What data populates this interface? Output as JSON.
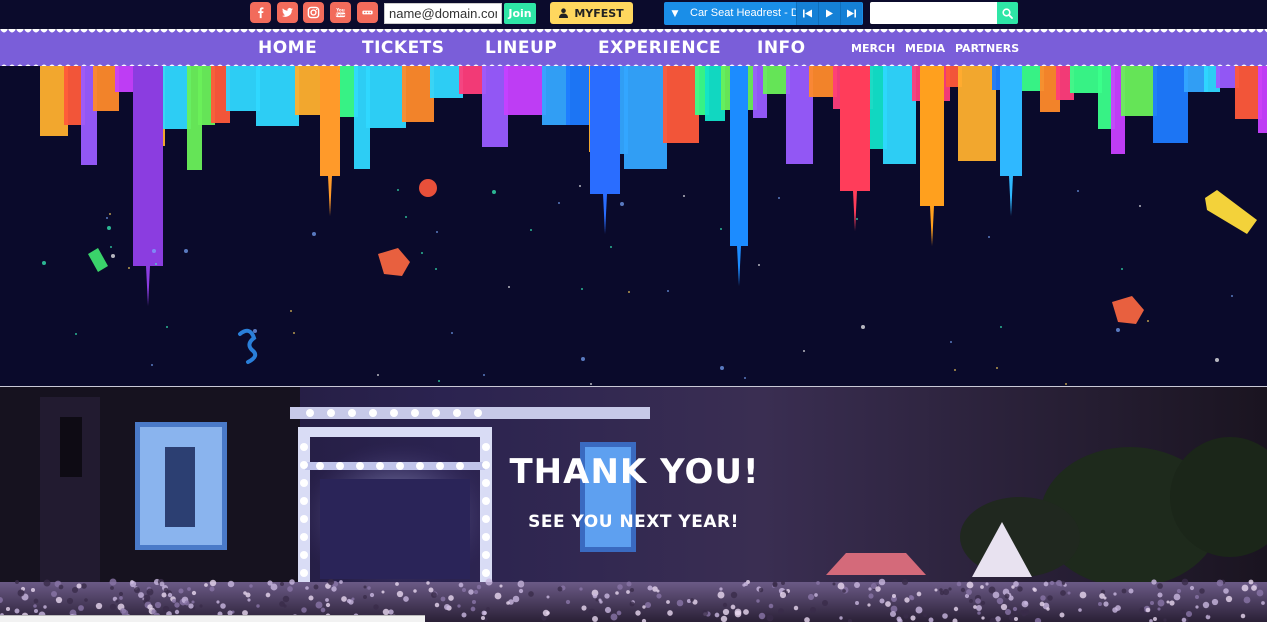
{
  "topbar": {
    "social": [
      {
        "name": "facebook-icon",
        "glyph": "f"
      },
      {
        "name": "twitter-icon",
        "glyph": ""
      },
      {
        "name": "instagram-icon",
        "glyph": ""
      },
      {
        "name": "youtube-icon",
        "glyph": "You Tube"
      },
      {
        "name": "more-icon",
        "glyph": "•••"
      }
    ],
    "email_value": "name@domain.com",
    "join_label": "Join",
    "myfest_label": "MYFEST",
    "player_track": "Car Seat Headrest - Dr",
    "search_value": ""
  },
  "nav": {
    "primary": [
      "HOME",
      "TICKETS",
      "LINEUP",
      "EXPERIENCE",
      "INFO"
    ],
    "secondary": [
      "MERCH",
      "MEDIA",
      "PARTNERS"
    ]
  },
  "hero": {
    "heading": "THANK YOU!",
    "subheading": "SEE YOU NEXT YEAR!"
  },
  "colors": {
    "social": "#f26b5b",
    "nav": "#7a5ed9",
    "join": "#2ee6a6",
    "myfest": "#ffd75e",
    "player": "#1a8ee8",
    "background": "#0a0a2b"
  }
}
